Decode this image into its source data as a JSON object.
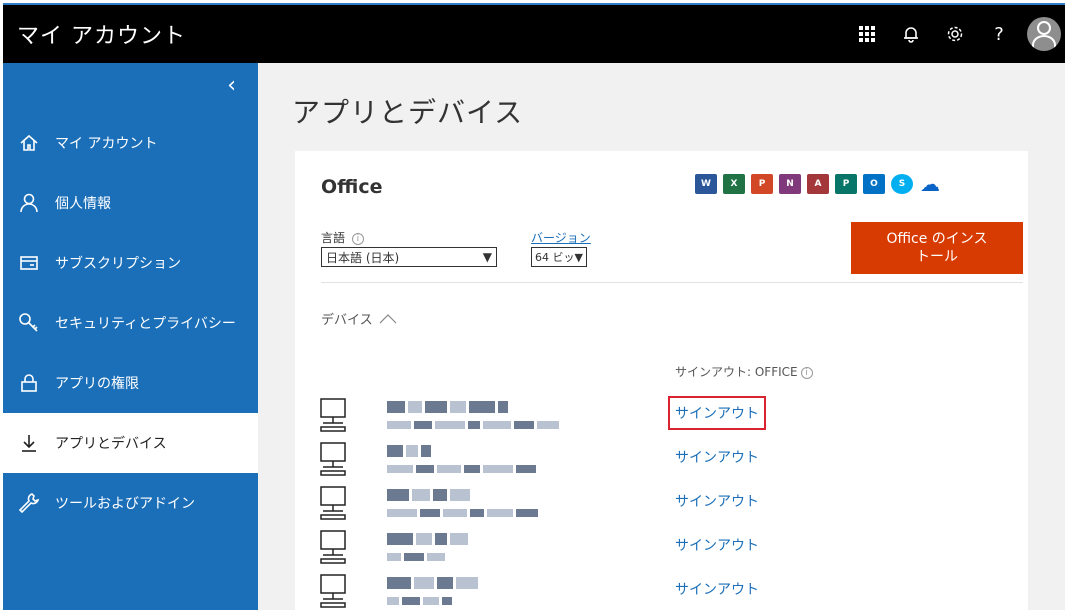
{
  "app": {
    "title": "マイ アカウント"
  },
  "topbar": {
    "icons": [
      "app-launcher-icon",
      "bell-icon",
      "gear-icon",
      "help-icon",
      "avatar-icon"
    ],
    "help_glyph": "?"
  },
  "sidebar": {
    "collapse_glyph": "‹",
    "items": [
      {
        "label": "マイ アカウント",
        "icon": "home-icon"
      },
      {
        "label": "個人情報",
        "icon": "person-icon"
      },
      {
        "label": "サブスクリプション",
        "icon": "card-icon"
      },
      {
        "label": "セキュリティとプライバシー",
        "icon": "key-icon"
      },
      {
        "label": "アプリの権限",
        "icon": "lock-icon"
      },
      {
        "label": "アプリとデバイス",
        "icon": "download-icon",
        "active": true
      },
      {
        "label": "ツールおよびアドイン",
        "icon": "wrench-icon"
      }
    ]
  },
  "main": {
    "title": "アプリとデバイス",
    "office": {
      "title": "Office",
      "apps": [
        {
          "name": "word-icon",
          "letter": "W",
          "color": "#2b579a"
        },
        {
          "name": "excel-icon",
          "letter": "X",
          "color": "#217346"
        },
        {
          "name": "powerpoint-icon",
          "letter": "P",
          "color": "#d24726"
        },
        {
          "name": "onenote-icon",
          "letter": "N",
          "color": "#80397b"
        },
        {
          "name": "access-icon",
          "letter": "A",
          "color": "#a4373a"
        },
        {
          "name": "publisher-icon",
          "letter": "P",
          "color": "#077568"
        },
        {
          "name": "outlook-icon",
          "letter": "O",
          "color": "#0072c6"
        },
        {
          "name": "skype-icon",
          "letter": "S",
          "color": "#00aff0"
        },
        {
          "name": "onedrive-icon",
          "letter": "☁",
          "color": "#0a64c8"
        }
      ],
      "language_label": "言語",
      "language_value": "日本語 (日本)",
      "version_label": "バージョン",
      "version_value": "64 ビッ",
      "install_button": "Office のインストール",
      "install_line1": "Office のインス",
      "install_line2": "トール",
      "devices_label": "デバイス",
      "signout_header": "サインアウト: OFFICE",
      "devices": [
        {
          "signout": "サインアウト",
          "highlighted": true
        },
        {
          "signout": "サインアウト",
          "highlighted": false
        },
        {
          "signout": "サインアウト",
          "highlighted": false
        },
        {
          "signout": "サインアウト",
          "highlighted": false
        },
        {
          "signout": "サインアウト",
          "highlighted": false
        }
      ]
    }
  }
}
